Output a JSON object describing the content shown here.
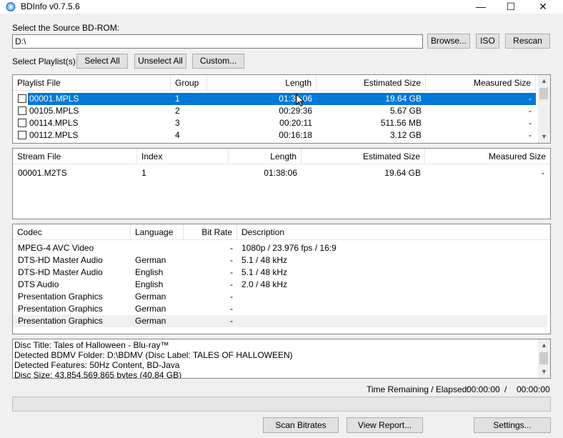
{
  "window": {
    "title": "BDInfo v0.7.5.6",
    "minimize": "—",
    "maximize": "☐",
    "close": "✕"
  },
  "source": {
    "label": "Select the Source BD-ROM:",
    "path": "D:\\",
    "browse": "Browse...",
    "iso": "ISO",
    "rescan": "Rescan"
  },
  "playlist_controls": {
    "label": "Select Playlist(s):",
    "select_all": "Select All",
    "unselect_all": "Unselect All",
    "custom": "Custom..."
  },
  "playlists": {
    "headers": {
      "file": "Playlist File",
      "group": "Group",
      "length": "Length",
      "est": "Estimated Size",
      "meas": "Measured Size"
    },
    "rows": [
      {
        "file": "00001.MPLS",
        "group": "1",
        "length": "01:38:06",
        "est": "19.64 GB",
        "meas": "-",
        "selected": true
      },
      {
        "file": "00105.MPLS",
        "group": "2",
        "length": "00:29:36",
        "est": "5.67 GB",
        "meas": "-"
      },
      {
        "file": "00114.MPLS",
        "group": "3",
        "length": "00:20:11",
        "est": "511.56 MB",
        "meas": "-"
      },
      {
        "file": "00112.MPLS",
        "group": "4",
        "length": "00:16:18",
        "est": "3.12 GB",
        "meas": "-"
      }
    ]
  },
  "streams": {
    "headers": {
      "file": "Stream File",
      "index": "Index",
      "length": "Length",
      "est": "Estimated Size",
      "meas": "Measured Size"
    },
    "rows": [
      {
        "file": "00001.M2TS",
        "index": "1",
        "length": "01:38:06",
        "est": "19.64 GB",
        "meas": "-"
      }
    ]
  },
  "codecs": {
    "headers": {
      "codec": "Codec",
      "language": "Language",
      "bitrate": "Bit Rate",
      "description": "Description"
    },
    "rows": [
      {
        "codec": "MPEG-4 AVC Video",
        "language": "",
        "bitrate": "-",
        "description": "1080p / 23.976 fps / 16:9"
      },
      {
        "codec": "DTS-HD Master Audio",
        "language": "German",
        "bitrate": "-",
        "description": "5.1 / 48 kHz"
      },
      {
        "codec": "DTS-HD Master Audio",
        "language": "English",
        "bitrate": "-",
        "description": "5.1 / 48 kHz"
      },
      {
        "codec": "DTS Audio",
        "language": "English",
        "bitrate": "-",
        "description": "2.0 / 48 kHz"
      },
      {
        "codec": "Presentation Graphics",
        "language": "German",
        "bitrate": "-",
        "description": ""
      },
      {
        "codec": "Presentation Graphics",
        "language": "German",
        "bitrate": "-",
        "description": ""
      },
      {
        "codec": "Presentation Graphics",
        "language": "German",
        "bitrate": "-",
        "description": ""
      }
    ]
  },
  "disc_info": {
    "lines": [
      "Disc Title: Tales of Halloween - Blu-ray™",
      "Detected BDMV Folder: D:\\BDMV (Disc Label: TALES OF HALLOWEEN)",
      "Detected Features: 50Hz Content, BD-Java",
      "Disc Size: 43,854,569,865 bytes (40.84 GB)"
    ]
  },
  "status": {
    "label": "Time Remaining / Elapsed:",
    "remaining": "00:00:00",
    "separator": "/",
    "elapsed": "00:00:00"
  },
  "progress": 0,
  "actions": {
    "scan": "Scan Bitrates",
    "report": "View Report...",
    "settings": "Settings..."
  },
  "colors": {
    "selection": "#0078d7",
    "background": "#f0f0f0"
  }
}
